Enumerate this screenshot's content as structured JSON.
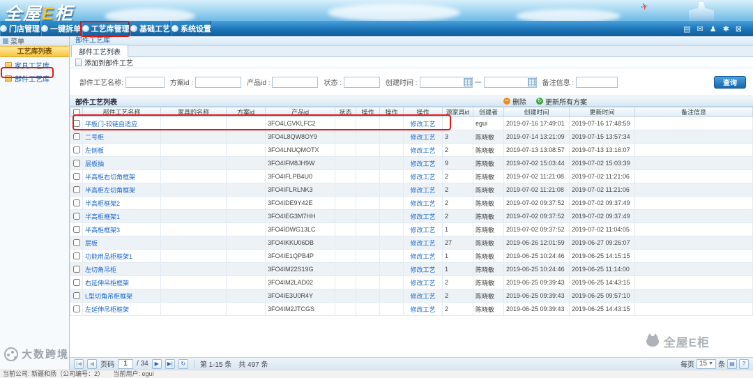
{
  "header": {
    "logo_prefix": "全屋",
    "logo_e": "E",
    "logo_suffix": "柜",
    "nav": [
      {
        "label": "门店管理"
      },
      {
        "label": "一键拆单"
      },
      {
        "label": "工艺库管理"
      },
      {
        "label": "基础工艺"
      },
      {
        "label": "系统设置"
      }
    ],
    "right_icons": [
      "app-grid-icon",
      "mail-icon",
      "user-icon",
      "gear-icon",
      "monitor-icon"
    ]
  },
  "sidebar": {
    "menu_title": "菜单",
    "section_title": "工艺库列表",
    "items": [
      {
        "label": "家具工艺库"
      },
      {
        "label": "部件工艺库"
      }
    ]
  },
  "main": {
    "breadcrumb": "部件工艺库",
    "tab": "部件工艺列表",
    "add_button": "添加到部件工艺"
  },
  "search": {
    "name_label": "部件工艺名称:",
    "scheme_label": "方案id :",
    "product_label": "产品id :",
    "status_label": "状态 :",
    "created_label": "创建时间 :",
    "date_separator": "一",
    "remark_label": "备注信息 :",
    "query_button": "查询"
  },
  "table": {
    "section_title": "部件工艺列表",
    "delete_button": "删除",
    "update_button": "更新所有方案",
    "columns": [
      "部件工艺名称",
      "家具的名称",
      "方案id",
      "产品id",
      "状态",
      "操作",
      "操作",
      "操作",
      "源家具id",
      "创建者",
      "创建时间",
      "更新时间",
      "备注信息"
    ],
    "rows": [
      {
        "name": "平板门-较链自适应",
        "furniture": "",
        "scheme_id": "",
        "product_id": "3FO4LGVKLFC2",
        "status": "",
        "op1": "",
        "op2": "",
        "action": "修改工艺",
        "source_id": "",
        "creator": "egui",
        "created": "2019-07-16 17:49:01",
        "updated": "2019-07-16 17:48:59",
        "remark": ""
      },
      {
        "name": "二号柜",
        "product_id": "3FO4L8QW8OY9",
        "action": "修改工艺",
        "source_id": "3",
        "creator": "陈晓敏",
        "created": "2019-07-14 13:21:09",
        "updated": "2019-07-15 13:57:34"
      },
      {
        "name": "左侧板",
        "product_id": "3FO4LNUQMOTX",
        "action": "修改工艺",
        "source_id": "2",
        "creator": "陈晓敏",
        "created": "2019-07-13 13:08:57",
        "updated": "2019-07-13 13:16:07"
      },
      {
        "name": "层板抽",
        "product_id": "3FO4IFM8JH9W",
        "action": "修改工艺",
        "source_id": "9",
        "creator": "陈晓敏",
        "created": "2019-07-02 15:03:44",
        "updated": "2019-07-02 15:03:39"
      },
      {
        "name": "半高柜右切角框架",
        "product_id": "3FO4IFLPB4U0",
        "action": "修改工艺",
        "source_id": "2",
        "creator": "陈晓敏",
        "created": "2019-07-02 11:21:08",
        "updated": "2019-07-02 11:21:06"
      },
      {
        "name": "半高柜左切角框架",
        "product_id": "3FO4IFLRLNK3",
        "action": "修改工艺",
        "source_id": "2",
        "creator": "陈晓敏",
        "created": "2019-07-02 11:21:08",
        "updated": "2019-07-02 11:21:06"
      },
      {
        "name": "半高柜框架2",
        "product_id": "3FO4IDE9Y42E",
        "action": "修改工艺",
        "source_id": "2",
        "creator": "陈晓敏",
        "created": "2019-07-02 09:37:52",
        "updated": "2019-07-02 09:37:49"
      },
      {
        "name": "半高柜框架1",
        "product_id": "3FO4IEG3M7HH",
        "action": "修改工艺",
        "source_id": "2",
        "creator": "陈晓敏",
        "created": "2019-07-02 09:37:52",
        "updated": "2019-07-02 09:37:49"
      },
      {
        "name": "半高柜框架3",
        "product_id": "3FO4IDWG13LC",
        "action": "修改工艺",
        "source_id": "1",
        "creator": "陈晓敏",
        "created": "2019-07-02 09:37:52",
        "updated": "2019-07-02 11:04:05"
      },
      {
        "name": "层板",
        "product_id": "3FO4IKKU06DB",
        "action": "修改工艺",
        "source_id": "27",
        "creator": "陈晓敏",
        "created": "2019-06-26 12:01:59",
        "updated": "2019-06-27 09:26:07"
      },
      {
        "name": "功能用品柜框架1",
        "product_id": "3FO4IE1QPB4P",
        "action": "修改工艺",
        "source_id": "1",
        "creator": "陈晓敏",
        "created": "2019-06-25 10:24:46",
        "updated": "2019-06-25 14:15:15"
      },
      {
        "name": "左切角吊柜",
        "product_id": "3FO4IM22S19G",
        "action": "修改工艺",
        "source_id": "1",
        "creator": "陈晓敏",
        "created": "2019-06-25 10:24:46",
        "updated": "2019-06-25 11:14:00"
      },
      {
        "name": "右延伸吊柜框架",
        "product_id": "3FO4IM2LAD02",
        "action": "修改工艺",
        "source_id": "2",
        "creator": "陈晓敏",
        "created": "2019-06-25 09:39:43",
        "updated": "2019-06-25 14:43:15"
      },
      {
        "name": "L型切角吊柜框架",
        "product_id": "3FO4IE3U0R4Y",
        "action": "修改工艺",
        "source_id": "2",
        "creator": "陈晓敏",
        "created": "2019-06-25 09:39:43",
        "updated": "2019-06-25 09:57:10"
      },
      {
        "name": "左延伸吊柜框架",
        "product_id": "3FO4IM2JTCGS",
        "action": "修改工艺",
        "source_id": "2",
        "creator": "陈晓敏",
        "created": "2019-06-25 09:39:43",
        "updated": "2019-06-25 14:43:15"
      }
    ]
  },
  "pagination": {
    "page_label": "页码",
    "page_value": "1",
    "page_total": "/ 34",
    "range_text": "第 1-15 条　共 497 条",
    "per_page_label": "每页",
    "per_page_value": "15",
    "per_page_suffix": "条"
  },
  "footer": {
    "status": "当前公司: 新疆和扬（公司编号：2）　　当前用户: egui"
  },
  "watermarks": {
    "left": "大数跨境",
    "right": "全屋E柜"
  }
}
